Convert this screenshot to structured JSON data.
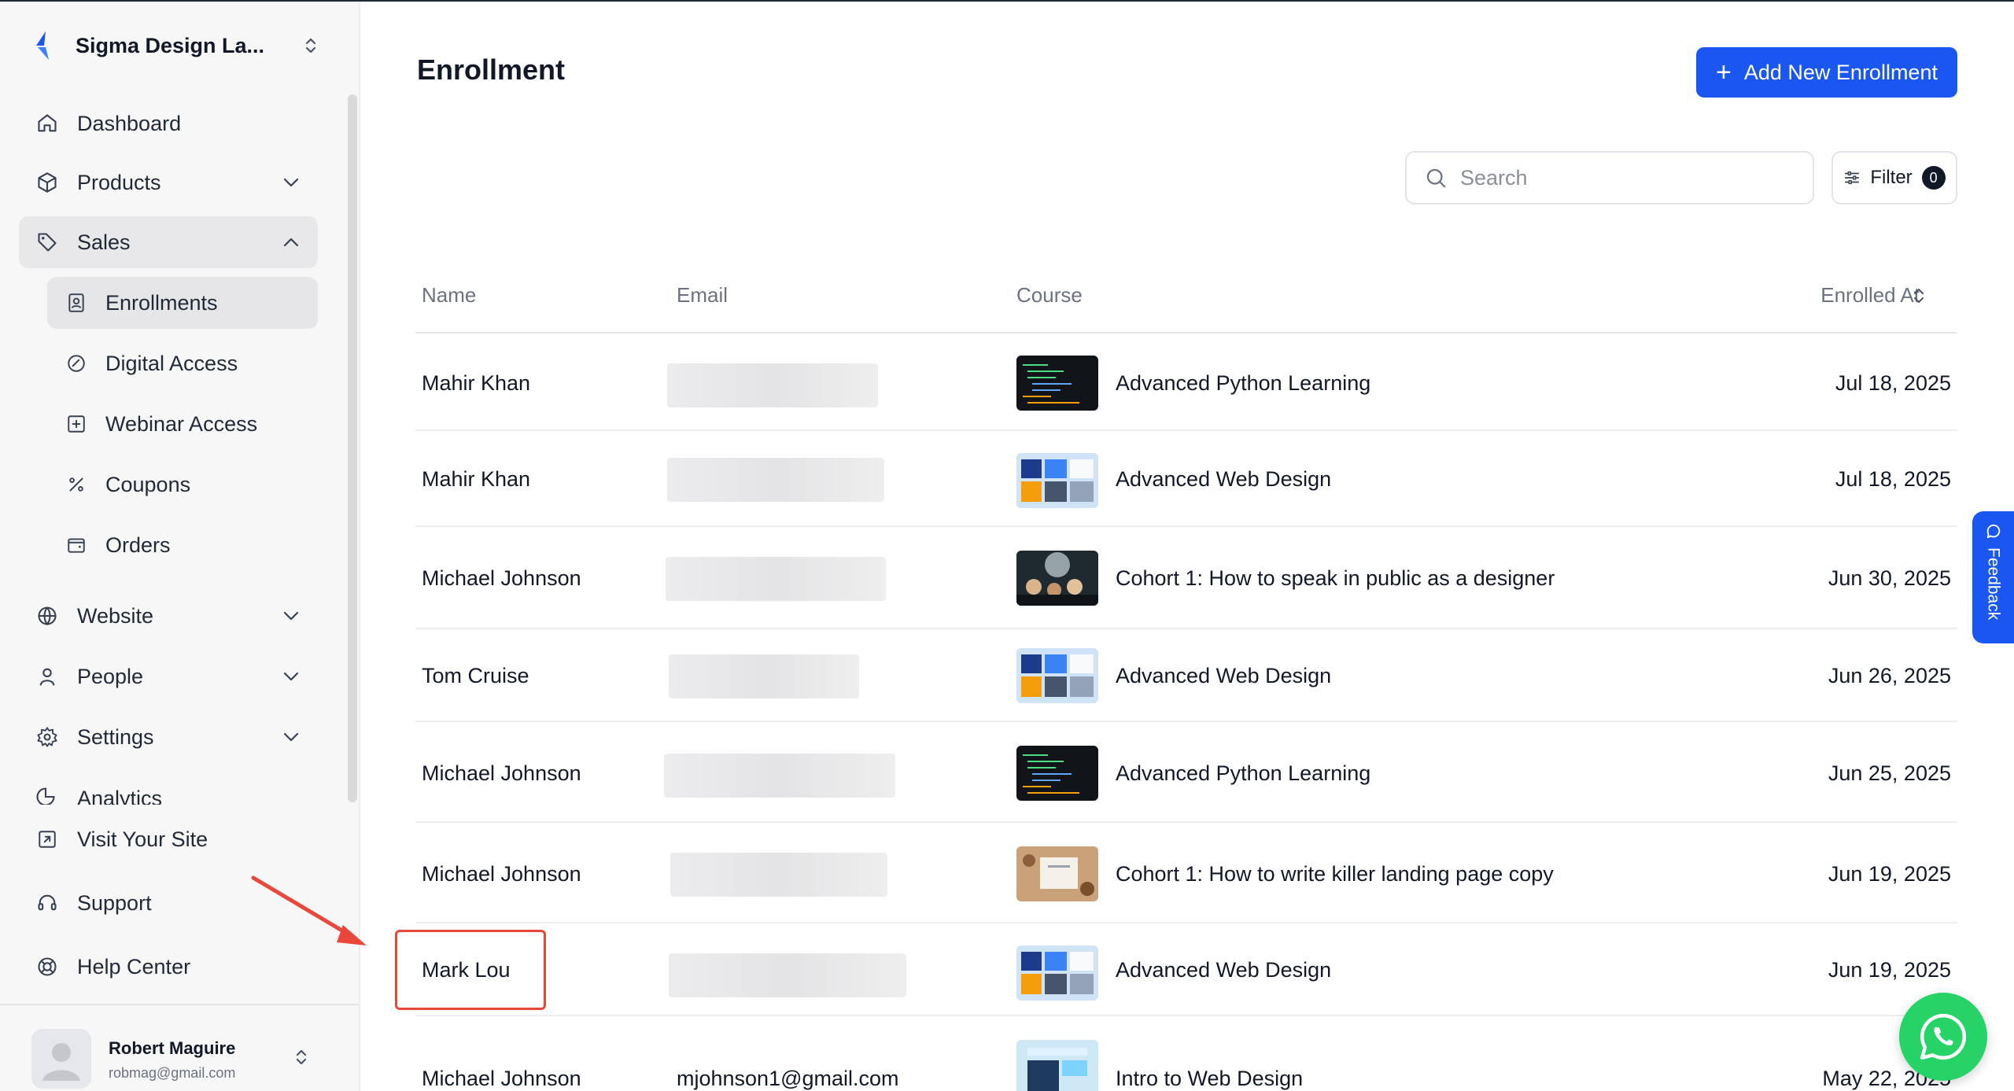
{
  "org": {
    "name": "Sigma Design La..."
  },
  "sidebar": {
    "items": [
      {
        "label": "Dashboard"
      },
      {
        "label": "Products"
      },
      {
        "label": "Sales"
      },
      {
        "label": "Website"
      },
      {
        "label": "People"
      },
      {
        "label": "Settings"
      },
      {
        "label": "Analytics"
      }
    ],
    "sales_sub": [
      {
        "label": "Enrollments"
      },
      {
        "label": "Digital Access"
      },
      {
        "label": "Webinar Access"
      },
      {
        "label": "Coupons"
      },
      {
        "label": "Orders"
      }
    ],
    "bottom": [
      {
        "label": "Visit Your Site"
      },
      {
        "label": "Support"
      },
      {
        "label": "Help Center"
      }
    ]
  },
  "user": {
    "name": "Robert Maguire",
    "email": "robmag@gmail.com"
  },
  "page": {
    "title": "Enrollment",
    "add_button": "Add New Enrollment"
  },
  "search": {
    "placeholder": "Search"
  },
  "filter": {
    "label": "Filter",
    "count": "0"
  },
  "table": {
    "headers": {
      "name": "Name",
      "email": "Email",
      "course": "Course",
      "enrolled_at": "Enrolled At"
    },
    "rows": [
      {
        "name": "Mahir Khan",
        "email": "",
        "course": "Advanced Python Learning",
        "date": "Jul 18, 2025"
      },
      {
        "name": "Mahir Khan",
        "email": "",
        "course": "Advanced Web Design",
        "date": "Jul 18, 2025"
      },
      {
        "name": "Michael Johnson",
        "email": "",
        "course": "Cohort 1: How to speak in public as a designer",
        "date": "Jun 30, 2025"
      },
      {
        "name": "Tom Cruise",
        "email": "",
        "course": "Advanced Web Design",
        "date": "Jun 26, 2025"
      },
      {
        "name": "Michael Johnson",
        "email": "",
        "course": "Advanced Python Learning",
        "date": "Jun 25, 2025"
      },
      {
        "name": "Michael Johnson",
        "email": "",
        "course": "Cohort 1: How to write killer landing page copy",
        "date": "Jun 19, 2025"
      },
      {
        "name": "Mark Lou",
        "email": "",
        "course": "Advanced Web Design",
        "date": "Jun 19, 2025"
      },
      {
        "name": "Michael Johnson",
        "email": "mjohnson1@gmail.com",
        "course": "Intro to Web Design",
        "date": "May 22, 2025"
      }
    ]
  },
  "feedback": {
    "label": "Feedback"
  },
  "colors": {
    "accent": "#1a56f0",
    "highlight": "#e8473a",
    "whatsapp": "#25d366"
  }
}
